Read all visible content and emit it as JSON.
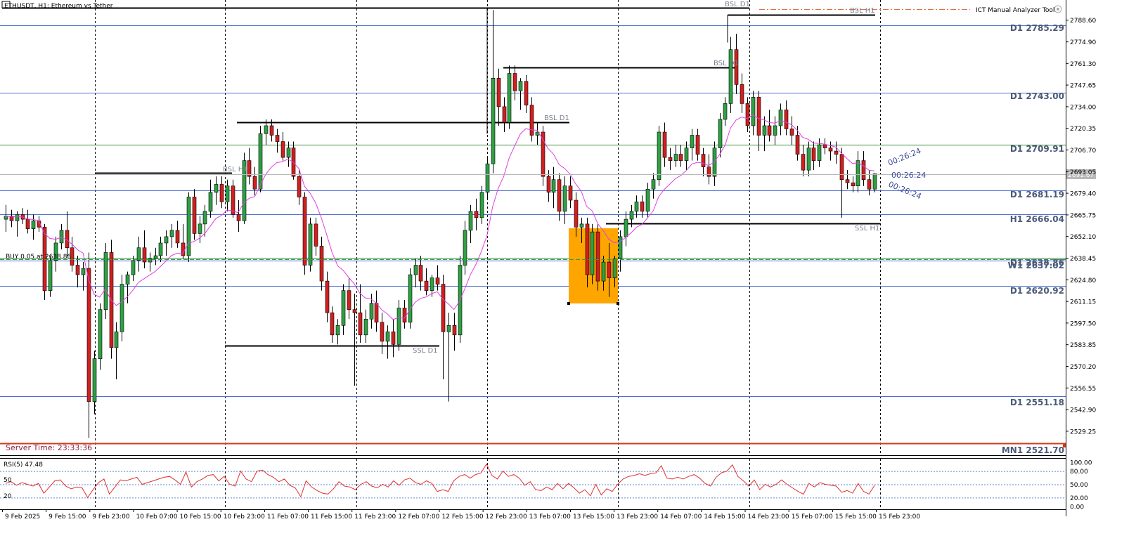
{
  "window_title": "ETHUSDT, H1:  Ethereum vs Tether",
  "tool_name": "ICT Manual Analyzer Tool",
  "server_time": "Server Time: 23:33:36",
  "buy_order_label": "BUY 0.05 at 2638.86",
  "current_price_label": "2691.67",
  "countdown": "00:26:24",
  "rsi_label": "RSI(5) 47.48",
  "rsi_left_labels": [
    "50",
    "20"
  ],
  "price_axis_labels": [
    "2788.60",
    "2774.90",
    "2761.30",
    "2747.65",
    "2734.00",
    "2720.35",
    "2706.70",
    "2693.05",
    "2679.40",
    "2665.75",
    "2652.10",
    "2638.45",
    "2624.80",
    "2611.15",
    "2597.50",
    "2583.85",
    "2570.20",
    "2556.55",
    "2542.90",
    "2529.25"
  ],
  "rsi_axis_labels": [
    "100.00",
    "80.00",
    "50.00",
    "20.00",
    "0.00"
  ],
  "time_labels": [
    "9 Feb 2025",
    "9 Feb 15:00",
    "9 Feb 23:00",
    "10 Feb 07:00",
    "10 Feb 15:00",
    "10 Feb 23:00",
    "11 Feb 07:00",
    "11 Feb 15:00",
    "11 Feb 23:00",
    "12 Feb 07:00",
    "12 Feb 15:00",
    "12 Feb 23:00",
    "13 Feb 07:00",
    "13 Feb 15:00",
    "13 Feb 23:00",
    "14 Feb 07:00",
    "14 Feb 15:00",
    "14 Feb 23:00",
    "15 Feb 07:00",
    "15 Feb 15:00",
    "15 Feb 23:00"
  ],
  "levels": [
    {
      "label": "D1 2785.29",
      "price": 2785.29,
      "color": "#4d6fd1"
    },
    {
      "label": "D1 2743.00",
      "price": 2743.0,
      "color": "#4d6fd1"
    },
    {
      "label": "D1 2709.91",
      "price": 2709.91,
      "color": "#3a8a3a"
    },
    {
      "label": "D1 2681.19",
      "price": 2681.19,
      "color": "#4d6fd1"
    },
    {
      "label": "H1 2666.04",
      "price": 2666.04,
      "color": "#4d6fd1"
    },
    {
      "label": "D1 2638.86",
      "price": 2638.86,
      "color": "#3a8a3a"
    },
    {
      "label": "W1 2637.02",
      "price": 2637.02,
      "color": "#4d6fd1"
    },
    {
      "label": "D1 2620.92",
      "price": 2620.92,
      "color": "#4d6fd1"
    },
    {
      "label": "D1 2551.18",
      "price": 2551.18,
      "color": "#4d6fd1"
    },
    {
      "label": "MN1 2521.70",
      "price": 2521.7,
      "color": "#d43a1a"
    }
  ],
  "liquidity_tags": [
    "BSL D1",
    "BSL H1",
    "BSL D1",
    "BSL D1",
    "BSL H1",
    "SSL D1",
    "SSL H1"
  ],
  "colors": {
    "bull": "#2ea043",
    "bear": "#d11f1f",
    "ma": "#e040e0",
    "rsi": "#e03030",
    "zone": "#ffa500",
    "level_blue": "#4d6fd1",
    "level_green": "#3a8a3a",
    "level_red": "#d43a1a"
  },
  "chart_data": {
    "type": "candlestick",
    "symbol": "ETHUSDT",
    "timeframe": "H1",
    "ylim": [
      2521.7,
      2795
    ],
    "rsi_ylim": [
      0,
      100
    ],
    "candles": [
      {
        "o": 2663,
        "h": 2672,
        "l": 2655,
        "c": 2665
      },
      {
        "o": 2665,
        "h": 2669,
        "l": 2658,
        "c": 2662
      },
      {
        "o": 2662,
        "h": 2668,
        "l": 2652,
        "c": 2666
      },
      {
        "o": 2666,
        "h": 2670,
        "l": 2660,
        "c": 2663
      },
      {
        "o": 2663,
        "h": 2669,
        "l": 2654,
        "c": 2657
      },
      {
        "o": 2657,
        "h": 2666,
        "l": 2650,
        "c": 2662
      },
      {
        "o": 2662,
        "h": 2665,
        "l": 2655,
        "c": 2658
      },
      {
        "o": 2658,
        "h": 2660,
        "l": 2612,
        "c": 2618
      },
      {
        "o": 2618,
        "h": 2640,
        "l": 2614,
        "c": 2637
      },
      {
        "o": 2637,
        "h": 2652,
        "l": 2630,
        "c": 2648
      },
      {
        "o": 2648,
        "h": 2660,
        "l": 2644,
        "c": 2656
      },
      {
        "o": 2656,
        "h": 2668,
        "l": 2640,
        "c": 2645
      },
      {
        "o": 2645,
        "h": 2652,
        "l": 2630,
        "c": 2634
      },
      {
        "o": 2634,
        "h": 2640,
        "l": 2620,
        "c": 2628
      },
      {
        "o": 2628,
        "h": 2636,
        "l": 2618,
        "c": 2632
      },
      {
        "o": 2632,
        "h": 2642,
        "l": 2525,
        "c": 2548
      },
      {
        "o": 2548,
        "h": 2580,
        "l": 2540,
        "c": 2575
      },
      {
        "o": 2575,
        "h": 2610,
        "l": 2568,
        "c": 2606
      },
      {
        "o": 2606,
        "h": 2648,
        "l": 2600,
        "c": 2642
      },
      {
        "o": 2642,
        "h": 2650,
        "l": 2575,
        "c": 2582
      },
      {
        "o": 2582,
        "h": 2598,
        "l": 2562,
        "c": 2592
      },
      {
        "o": 2592,
        "h": 2628,
        "l": 2586,
        "c": 2622
      },
      {
        "o": 2622,
        "h": 2630,
        "l": 2610,
        "c": 2628
      },
      {
        "o": 2628,
        "h": 2640,
        "l": 2624,
        "c": 2637
      },
      {
        "o": 2637,
        "h": 2652,
        "l": 2630,
        "c": 2645
      },
      {
        "o": 2645,
        "h": 2656,
        "l": 2632,
        "c": 2636
      },
      {
        "o": 2636,
        "h": 2642,
        "l": 2630,
        "c": 2638
      },
      {
        "o": 2638,
        "h": 2645,
        "l": 2634,
        "c": 2640
      },
      {
        "o": 2640,
        "h": 2652,
        "l": 2636,
        "c": 2648
      },
      {
        "o": 2648,
        "h": 2656,
        "l": 2640,
        "c": 2652
      },
      {
        "o": 2652,
        "h": 2660,
        "l": 2645,
        "c": 2656
      },
      {
        "o": 2656,
        "h": 2662,
        "l": 2645,
        "c": 2648
      },
      {
        "o": 2648,
        "h": 2660,
        "l": 2638,
        "c": 2640
      },
      {
        "o": 2640,
        "h": 2680,
        "l": 2636,
        "c": 2677
      },
      {
        "o": 2677,
        "h": 2682,
        "l": 2650,
        "c": 2654
      },
      {
        "o": 2654,
        "h": 2665,
        "l": 2648,
        "c": 2660
      },
      {
        "o": 2660,
        "h": 2672,
        "l": 2652,
        "c": 2668
      },
      {
        "o": 2668,
        "h": 2688,
        "l": 2664,
        "c": 2680
      },
      {
        "o": 2680,
        "h": 2690,
        "l": 2672,
        "c": 2685
      },
      {
        "o": 2685,
        "h": 2690,
        "l": 2670,
        "c": 2674
      },
      {
        "o": 2674,
        "h": 2688,
        "l": 2668,
        "c": 2684
      },
      {
        "o": 2684,
        "h": 2688,
        "l": 2664,
        "c": 2666
      },
      {
        "o": 2666,
        "h": 2675,
        "l": 2655,
        "c": 2662
      },
      {
        "o": 2662,
        "h": 2705,
        "l": 2660,
        "c": 2700
      },
      {
        "o": 2700,
        "h": 2708,
        "l": 2685,
        "c": 2690
      },
      {
        "o": 2690,
        "h": 2696,
        "l": 2678,
        "c": 2682
      },
      {
        "o": 2682,
        "h": 2722,
        "l": 2680,
        "c": 2717
      },
      {
        "o": 2717,
        "h": 2726,
        "l": 2710,
        "c": 2722
      },
      {
        "o": 2722,
        "h": 2726,
        "l": 2712,
        "c": 2716
      },
      {
        "o": 2716,
        "h": 2720,
        "l": 2705,
        "c": 2712
      },
      {
        "o": 2712,
        "h": 2718,
        "l": 2700,
        "c": 2702
      },
      {
        "o": 2702,
        "h": 2712,
        "l": 2696,
        "c": 2708
      },
      {
        "o": 2708,
        "h": 2712,
        "l": 2688,
        "c": 2690
      },
      {
        "o": 2690,
        "h": 2695,
        "l": 2672,
        "c": 2677
      },
      {
        "o": 2677,
        "h": 2680,
        "l": 2628,
        "c": 2634
      },
      {
        "o": 2634,
        "h": 2664,
        "l": 2630,
        "c": 2660
      },
      {
        "o": 2660,
        "h": 2664,
        "l": 2640,
        "c": 2646
      },
      {
        "o": 2646,
        "h": 2652,
        "l": 2618,
        "c": 2624
      },
      {
        "o": 2624,
        "h": 2630,
        "l": 2598,
        "c": 2604
      },
      {
        "o": 2604,
        "h": 2608,
        "l": 2585,
        "c": 2590
      },
      {
        "o": 2590,
        "h": 2600,
        "l": 2584,
        "c": 2596
      },
      {
        "o": 2596,
        "h": 2622,
        "l": 2590,
        "c": 2618
      },
      {
        "o": 2618,
        "h": 2626,
        "l": 2600,
        "c": 2606
      },
      {
        "o": 2606,
        "h": 2616,
        "l": 2558,
        "c": 2604
      },
      {
        "o": 2604,
        "h": 2622,
        "l": 2585,
        "c": 2590
      },
      {
        "o": 2590,
        "h": 2606,
        "l": 2585,
        "c": 2600
      },
      {
        "o": 2600,
        "h": 2616,
        "l": 2594,
        "c": 2610
      },
      {
        "o": 2610,
        "h": 2618,
        "l": 2592,
        "c": 2598
      },
      {
        "o": 2598,
        "h": 2604,
        "l": 2578,
        "c": 2586
      },
      {
        "o": 2586,
        "h": 2596,
        "l": 2575,
        "c": 2592
      },
      {
        "o": 2592,
        "h": 2600,
        "l": 2576,
        "c": 2584
      },
      {
        "o": 2584,
        "h": 2612,
        "l": 2580,
        "c": 2607
      },
      {
        "o": 2607,
        "h": 2612,
        "l": 2594,
        "c": 2598
      },
      {
        "o": 2598,
        "h": 2632,
        "l": 2594,
        "c": 2628
      },
      {
        "o": 2628,
        "h": 2638,
        "l": 2620,
        "c": 2634
      },
      {
        "o": 2634,
        "h": 2640,
        "l": 2618,
        "c": 2624
      },
      {
        "o": 2624,
        "h": 2632,
        "l": 2615,
        "c": 2618
      },
      {
        "o": 2618,
        "h": 2628,
        "l": 2614,
        "c": 2626
      },
      {
        "o": 2626,
        "h": 2634,
        "l": 2618,
        "c": 2622
      },
      {
        "o": 2622,
        "h": 2628,
        "l": 2562,
        "c": 2592
      },
      {
        "o": 2592,
        "h": 2604,
        "l": 2548,
        "c": 2596
      },
      {
        "o": 2596,
        "h": 2604,
        "l": 2580,
        "c": 2590
      },
      {
        "o": 2590,
        "h": 2640,
        "l": 2585,
        "c": 2634
      },
      {
        "o": 2634,
        "h": 2662,
        "l": 2628,
        "c": 2656
      },
      {
        "o": 2656,
        "h": 2672,
        "l": 2648,
        "c": 2668
      },
      {
        "o": 2668,
        "h": 2676,
        "l": 2656,
        "c": 2664
      },
      {
        "o": 2664,
        "h": 2684,
        "l": 2660,
        "c": 2680
      },
      {
        "o": 2680,
        "h": 2702,
        "l": 2676,
        "c": 2698
      },
      {
        "o": 2698,
        "h": 2795,
        "l": 2692,
        "c": 2752
      },
      {
        "o": 2752,
        "h": 2758,
        "l": 2722,
        "c": 2734
      },
      {
        "o": 2734,
        "h": 2740,
        "l": 2718,
        "c": 2724
      },
      {
        "o": 2724,
        "h": 2760,
        "l": 2720,
        "c": 2755
      },
      {
        "o": 2755,
        "h": 2760,
        "l": 2738,
        "c": 2744
      },
      {
        "o": 2744,
        "h": 2752,
        "l": 2732,
        "c": 2750
      },
      {
        "o": 2750,
        "h": 2754,
        "l": 2730,
        "c": 2735
      },
      {
        "o": 2735,
        "h": 2740,
        "l": 2712,
        "c": 2716
      },
      {
        "o": 2716,
        "h": 2724,
        "l": 2710,
        "c": 2718
      },
      {
        "o": 2718,
        "h": 2722,
        "l": 2684,
        "c": 2690
      },
      {
        "o": 2690,
        "h": 2694,
        "l": 2674,
        "c": 2680
      },
      {
        "o": 2680,
        "h": 2696,
        "l": 2670,
        "c": 2688
      },
      {
        "o": 2688,
        "h": 2692,
        "l": 2662,
        "c": 2668
      },
      {
        "o": 2668,
        "h": 2690,
        "l": 2660,
        "c": 2684
      },
      {
        "o": 2684,
        "h": 2690,
        "l": 2670,
        "c": 2675
      },
      {
        "o": 2675,
        "h": 2680,
        "l": 2652,
        "c": 2658
      },
      {
        "o": 2658,
        "h": 2664,
        "l": 2648,
        "c": 2660
      },
      {
        "o": 2660,
        "h": 2664,
        "l": 2620,
        "c": 2628
      },
      {
        "o": 2628,
        "h": 2660,
        "l": 2622,
        "c": 2655
      },
      {
        "o": 2655,
        "h": 2660,
        "l": 2618,
        "c": 2624
      },
      {
        "o": 2624,
        "h": 2640,
        "l": 2618,
        "c": 2636
      },
      {
        "o": 2636,
        "h": 2648,
        "l": 2614,
        "c": 2626
      },
      {
        "o": 2626,
        "h": 2640,
        "l": 2620,
        "c": 2638
      },
      {
        "o": 2638,
        "h": 2656,
        "l": 2630,
        "c": 2652
      },
      {
        "o": 2652,
        "h": 2668,
        "l": 2646,
        "c": 2663
      },
      {
        "o": 2663,
        "h": 2672,
        "l": 2658,
        "c": 2668
      },
      {
        "o": 2668,
        "h": 2678,
        "l": 2664,
        "c": 2674
      },
      {
        "o": 2674,
        "h": 2678,
        "l": 2664,
        "c": 2668
      },
      {
        "o": 2668,
        "h": 2686,
        "l": 2664,
        "c": 2682
      },
      {
        "o": 2682,
        "h": 2692,
        "l": 2676,
        "c": 2688
      },
      {
        "o": 2688,
        "h": 2722,
        "l": 2684,
        "c": 2718
      },
      {
        "o": 2718,
        "h": 2724,
        "l": 2696,
        "c": 2702
      },
      {
        "o": 2702,
        "h": 2708,
        "l": 2694,
        "c": 2700
      },
      {
        "o": 2700,
        "h": 2710,
        "l": 2696,
        "c": 2704
      },
      {
        "o": 2704,
        "h": 2710,
        "l": 2696,
        "c": 2700
      },
      {
        "o": 2700,
        "h": 2712,
        "l": 2694,
        "c": 2708
      },
      {
        "o": 2708,
        "h": 2720,
        "l": 2700,
        "c": 2716
      },
      {
        "o": 2716,
        "h": 2720,
        "l": 2700,
        "c": 2704
      },
      {
        "o": 2704,
        "h": 2708,
        "l": 2690,
        "c": 2696
      },
      {
        "o": 2696,
        "h": 2704,
        "l": 2685,
        "c": 2690
      },
      {
        "o": 2690,
        "h": 2712,
        "l": 2684,
        "c": 2708
      },
      {
        "o": 2708,
        "h": 2730,
        "l": 2702,
        "c": 2726
      },
      {
        "o": 2726,
        "h": 2740,
        "l": 2722,
        "c": 2736
      },
      {
        "o": 2736,
        "h": 2778,
        "l": 2730,
        "c": 2770
      },
      {
        "o": 2770,
        "h": 2780,
        "l": 2742,
        "c": 2748
      },
      {
        "o": 2748,
        "h": 2755,
        "l": 2730,
        "c": 2736
      },
      {
        "o": 2736,
        "h": 2740,
        "l": 2718,
        "c": 2722
      },
      {
        "o": 2722,
        "h": 2744,
        "l": 2716,
        "c": 2740
      },
      {
        "o": 2740,
        "h": 2744,
        "l": 2706,
        "c": 2716
      },
      {
        "o": 2716,
        "h": 2728,
        "l": 2706,
        "c": 2722
      },
      {
        "o": 2722,
        "h": 2732,
        "l": 2712,
        "c": 2716
      },
      {
        "o": 2716,
        "h": 2728,
        "l": 2710,
        "c": 2722
      },
      {
        "o": 2722,
        "h": 2736,
        "l": 2716,
        "c": 2732
      },
      {
        "o": 2732,
        "h": 2738,
        "l": 2716,
        "c": 2720
      },
      {
        "o": 2720,
        "h": 2728,
        "l": 2710,
        "c": 2716
      },
      {
        "o": 2716,
        "h": 2722,
        "l": 2700,
        "c": 2704
      },
      {
        "o": 2704,
        "h": 2710,
        "l": 2690,
        "c": 2694
      },
      {
        "o": 2694,
        "h": 2712,
        "l": 2690,
        "c": 2708
      },
      {
        "o": 2708,
        "h": 2712,
        "l": 2694,
        "c": 2700
      },
      {
        "o": 2700,
        "h": 2714,
        "l": 2696,
        "c": 2710
      },
      {
        "o": 2710,
        "h": 2714,
        "l": 2704,
        "c": 2708
      },
      {
        "o": 2708,
        "h": 2712,
        "l": 2700,
        "c": 2706
      },
      {
        "o": 2706,
        "h": 2712,
        "l": 2698,
        "c": 2704
      },
      {
        "o": 2704,
        "h": 2708,
        "l": 2664,
        "c": 2688
      },
      {
        "o": 2688,
        "h": 2694,
        "l": 2682,
        "c": 2686
      },
      {
        "o": 2686,
        "h": 2690,
        "l": 2680,
        "c": 2684
      },
      {
        "o": 2684,
        "h": 2706,
        "l": 2680,
        "c": 2700
      },
      {
        "o": 2700,
        "h": 2706,
        "l": 2684,
        "c": 2688
      },
      {
        "o": 2688,
        "h": 2694,
        "l": 2678,
        "c": 2682
      },
      {
        "o": 2682,
        "h": 2692,
        "l": 2680,
        "c": 2691.67
      }
    ],
    "rsi": [
      52,
      56,
      48,
      54,
      50,
      46,
      52,
      30,
      44,
      58,
      60,
      46,
      40,
      44,
      42,
      20,
      38,
      54,
      62,
      28,
      44,
      60,
      58,
      62,
      66,
      50,
      54,
      58,
      62,
      66,
      68,
      60,
      50,
      78,
      44,
      56,
      62,
      70,
      72,
      58,
      68,
      50,
      46,
      80,
      62,
      56,
      80,
      82,
      72,
      66,
      56,
      62,
      48,
      42,
      22,
      58,
      44,
      36,
      30,
      28,
      40,
      56,
      46,
      44,
      38,
      50,
      56,
      46,
      42,
      50,
      44,
      58,
      48,
      60,
      64,
      54,
      50,
      58,
      52,
      34,
      38,
      34,
      58,
      68,
      72,
      64,
      72,
      76,
      96,
      70,
      62,
      80,
      68,
      72,
      64,
      48,
      56,
      38,
      36,
      44,
      38,
      52,
      40,
      52,
      42,
      30,
      38,
      24,
      50,
      26,
      40,
      34,
      50,
      62,
      68,
      70,
      74,
      70,
      74,
      76,
      92,
      64,
      62,
      66,
      62,
      68,
      72,
      64,
      52,
      46,
      66,
      76,
      80,
      94,
      68,
      58,
      46,
      60,
      38,
      50,
      44,
      50,
      60,
      50,
      42,
      34,
      28,
      52,
      44,
      54,
      50,
      48,
      46,
      32,
      36,
      30,
      52,
      34,
      28,
      47.48
    ]
  }
}
